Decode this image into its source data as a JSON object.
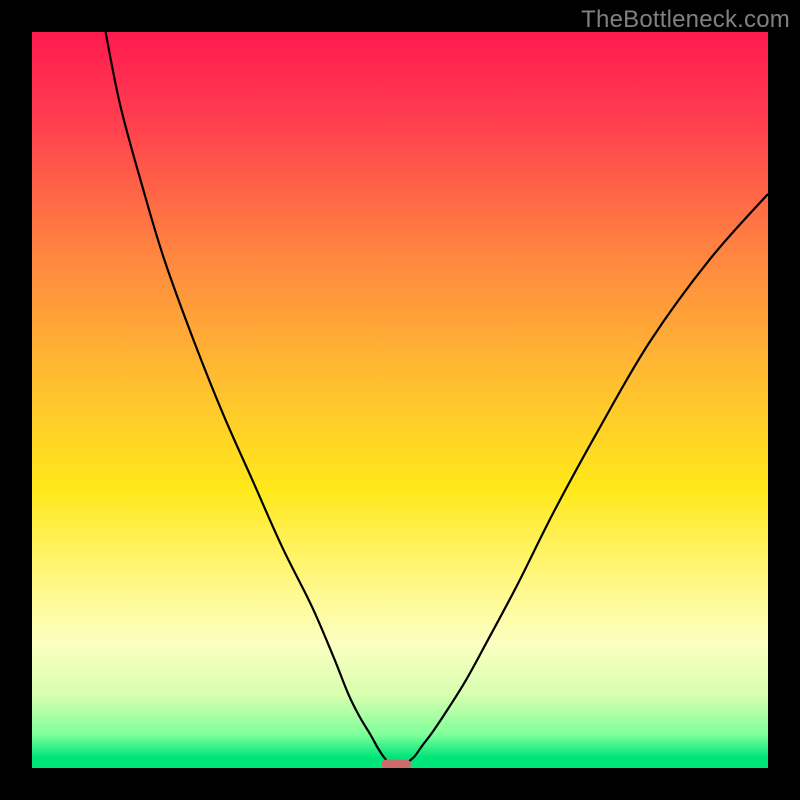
{
  "watermark": "TheBottleneck.com",
  "chart_data": {
    "type": "line",
    "title": "",
    "xlabel": "",
    "ylabel": "",
    "xlim": [
      0,
      100
    ],
    "ylim": [
      0,
      100
    ],
    "grid": false,
    "legend": null,
    "background_gradient": {
      "type": "vertical",
      "stops": [
        {
          "pos": 0.0,
          "color": "#ff1a4f"
        },
        {
          "pos": 0.12,
          "color": "#ff3e4f"
        },
        {
          "pos": 0.3,
          "color": "#ff8540"
        },
        {
          "pos": 0.48,
          "color": "#ffc030"
        },
        {
          "pos": 0.62,
          "color": "#ffe81a"
        },
        {
          "pos": 0.76,
          "color": "#fff98f"
        },
        {
          "pos": 0.83,
          "color": "#fcffc0"
        },
        {
          "pos": 0.9,
          "color": "#d8ffb0"
        },
        {
          "pos": 0.955,
          "color": "#7eff9a"
        },
        {
          "pos": 0.985,
          "color": "#00e57a"
        },
        {
          "pos": 1.0,
          "color": "#00e57a"
        }
      ]
    },
    "series": [
      {
        "name": "left-branch",
        "x": [
          10,
          12,
          15,
          18,
          22,
          26,
          30,
          34,
          38,
          41,
          43,
          44.5,
          46,
          47,
          47.8,
          48.3
        ],
        "y": [
          100,
          90,
          79,
          69,
          58,
          48,
          39,
          30,
          22,
          15,
          10,
          7,
          4.5,
          2.7,
          1.5,
          0.9
        ]
      },
      {
        "name": "right-branch",
        "x": [
          51.2,
          52,
          53,
          54.5,
          56.5,
          59,
          62,
          66,
          71,
          77,
          84,
          92,
          100
        ],
        "y": [
          0.9,
          1.6,
          3.0,
          5.0,
          8.0,
          12.0,
          17.5,
          25,
          35,
          46,
          58,
          69,
          78
        ]
      }
    ],
    "marker": {
      "name": "bottleneck-marker",
      "x_center": 49.5,
      "y_center": 0.5,
      "width": 4.0,
      "height": 1.3,
      "color": "#cc6b6b"
    }
  }
}
